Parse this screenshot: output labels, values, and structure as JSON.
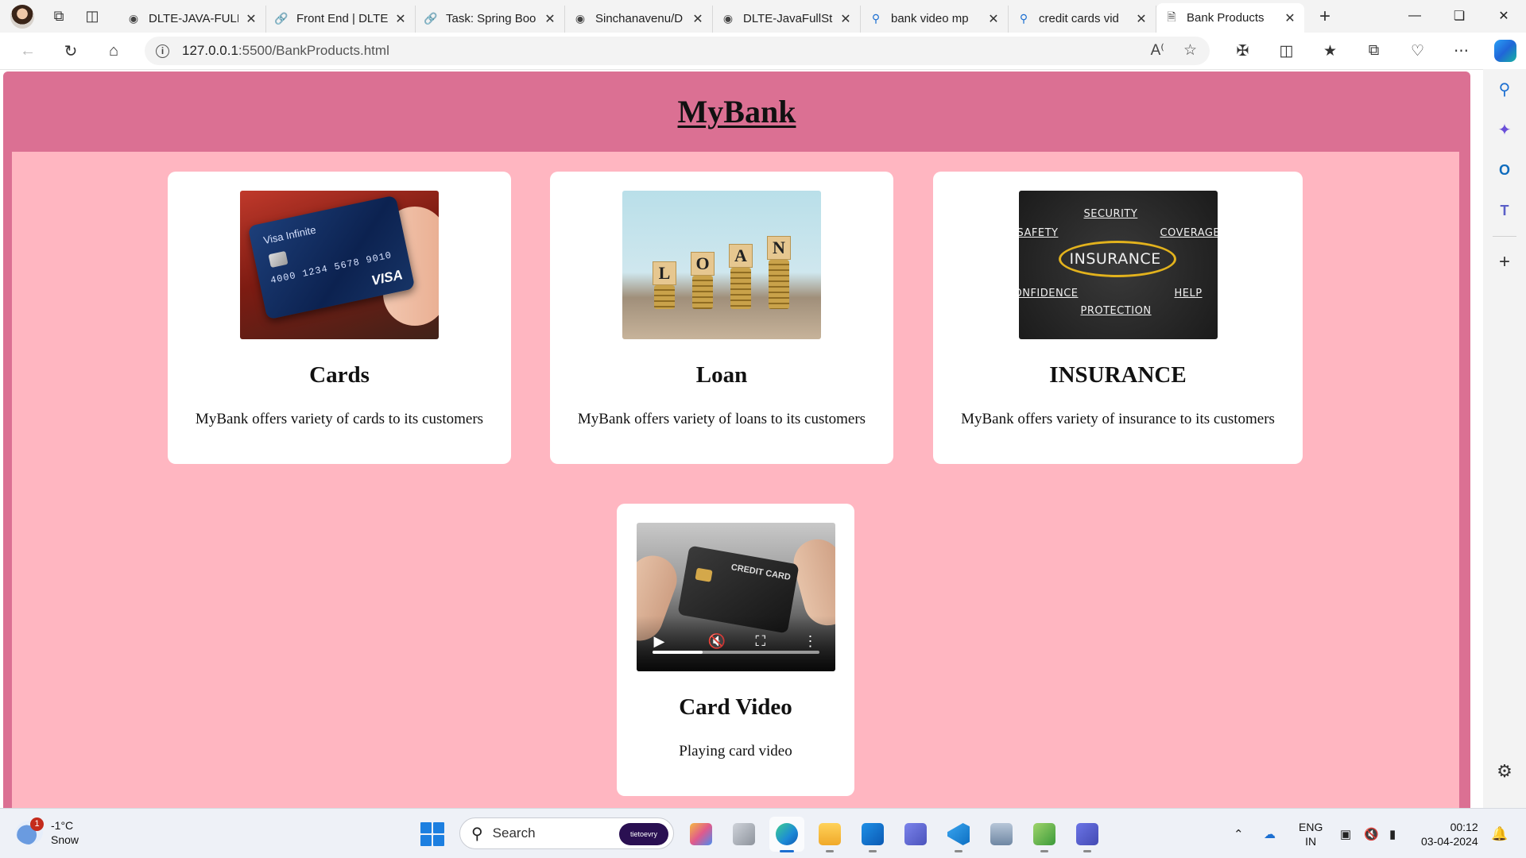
{
  "browser": {
    "tabs": [
      {
        "title": "DLTE-JAVA-FULL",
        "icon": "github-icon"
      },
      {
        "title": "Front End | DLTE",
        "icon": "link-icon"
      },
      {
        "title": "Task: Spring Boo",
        "icon": "link-icon"
      },
      {
        "title": "Sinchanavenu/D",
        "icon": "github-icon"
      },
      {
        "title": "DLTE-JavaFullSt",
        "icon": "github-icon"
      },
      {
        "title": "bank video mp",
        "icon": "search-icon"
      },
      {
        "title": "credit cards vid",
        "icon": "search-icon"
      },
      {
        "title": "Bank Products",
        "icon": "page-icon"
      }
    ],
    "active_tab_index": 7,
    "address": {
      "host": "127.0.0.1",
      "path": ":5500/BankProducts.html"
    }
  },
  "page": {
    "brand": "MyBank",
    "cards": [
      {
        "title": "Cards",
        "text": "MyBank offers variety of cards to its customers"
      },
      {
        "title": "Loan",
        "text": "MyBank offers variety of loans to its customers"
      },
      {
        "title": "INSURANCE",
        "text": "MyBank offers variety of insurance to its customers"
      },
      {
        "title": "Card Video",
        "text": "Playing card video"
      }
    ],
    "images": {
      "card_image": {
        "line1": "Visa Infinite",
        "number": "4000 1234 5678 9010",
        "brand": "VISA"
      },
      "loan_image": {
        "letters": [
          "L",
          "O",
          "A",
          "N"
        ]
      },
      "insurance_image": {
        "center": "INSURANCE",
        "words": [
          "SECURITY",
          "SAFETY",
          "COVERAGE",
          "ONFIDENCE",
          "HELP",
          "PROTECTION"
        ]
      },
      "video_image": {
        "card_text": "CREDIT CARD",
        "progress": 0.3
      }
    }
  },
  "taskbar": {
    "weather": {
      "temp": "-1°C",
      "condition": "Snow",
      "badge": "1"
    },
    "search_label": "Search",
    "search_pill": "tietoevry",
    "language": {
      "line1": "ENG",
      "line2": "IN"
    },
    "clock": {
      "time": "00:12",
      "date": "03-04-2024"
    }
  },
  "colors": {
    "page_header": "#db7093",
    "page_background": "#ffb6c1",
    "card_background": "#ffffff"
  }
}
